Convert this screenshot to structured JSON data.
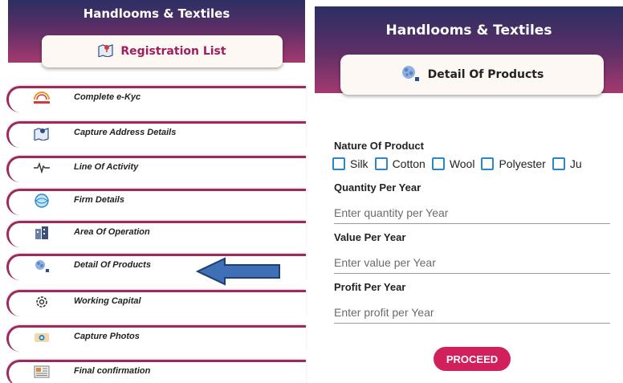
{
  "left": {
    "title": "Handlooms & Textiles",
    "card_title": "Registration List",
    "items": [
      {
        "label": "Complete e-Kyc",
        "icon": "aadhaar-icon"
      },
      {
        "label": "Capture Address Details",
        "icon": "map-pin-icon"
      },
      {
        "label": "Line Of Activity",
        "icon": "activity-icon"
      },
      {
        "label": "Firm Details",
        "icon": "firm-icon"
      },
      {
        "label": "Area Of Operation",
        "icon": "building-icon"
      },
      {
        "label": "Detail Of Products",
        "icon": "products-icon"
      },
      {
        "label": "Working Capital",
        "icon": "gear-icon"
      },
      {
        "label": "Capture Photos",
        "icon": "camera-icon"
      },
      {
        "label": "Final confirmation",
        "icon": "document-icon"
      }
    ]
  },
  "right": {
    "title": "Handlooms & Textiles",
    "card_title": "Detail Of Products",
    "nature_label": "Nature Of Product",
    "options": [
      "Silk",
      "Cotton",
      "Wool",
      "Polyester",
      "Ju"
    ],
    "quantity_label": "Quantity Per Year",
    "quantity_placeholder": "Enter quantity per Year",
    "value_label": "Value Per Year",
    "value_placeholder": "Enter value per Year",
    "profit_label": "Profit Per Year",
    "profit_placeholder": "Enter profit per Year",
    "proceed_label": "PROCEED"
  },
  "colors": {
    "header_start": "#2c2f63",
    "header_end": "#a43a6f",
    "accent": "#9e1f5a",
    "proceed": "#d1205c",
    "checkbox": "#2a86c9",
    "arrow": "#3f6fb5"
  }
}
